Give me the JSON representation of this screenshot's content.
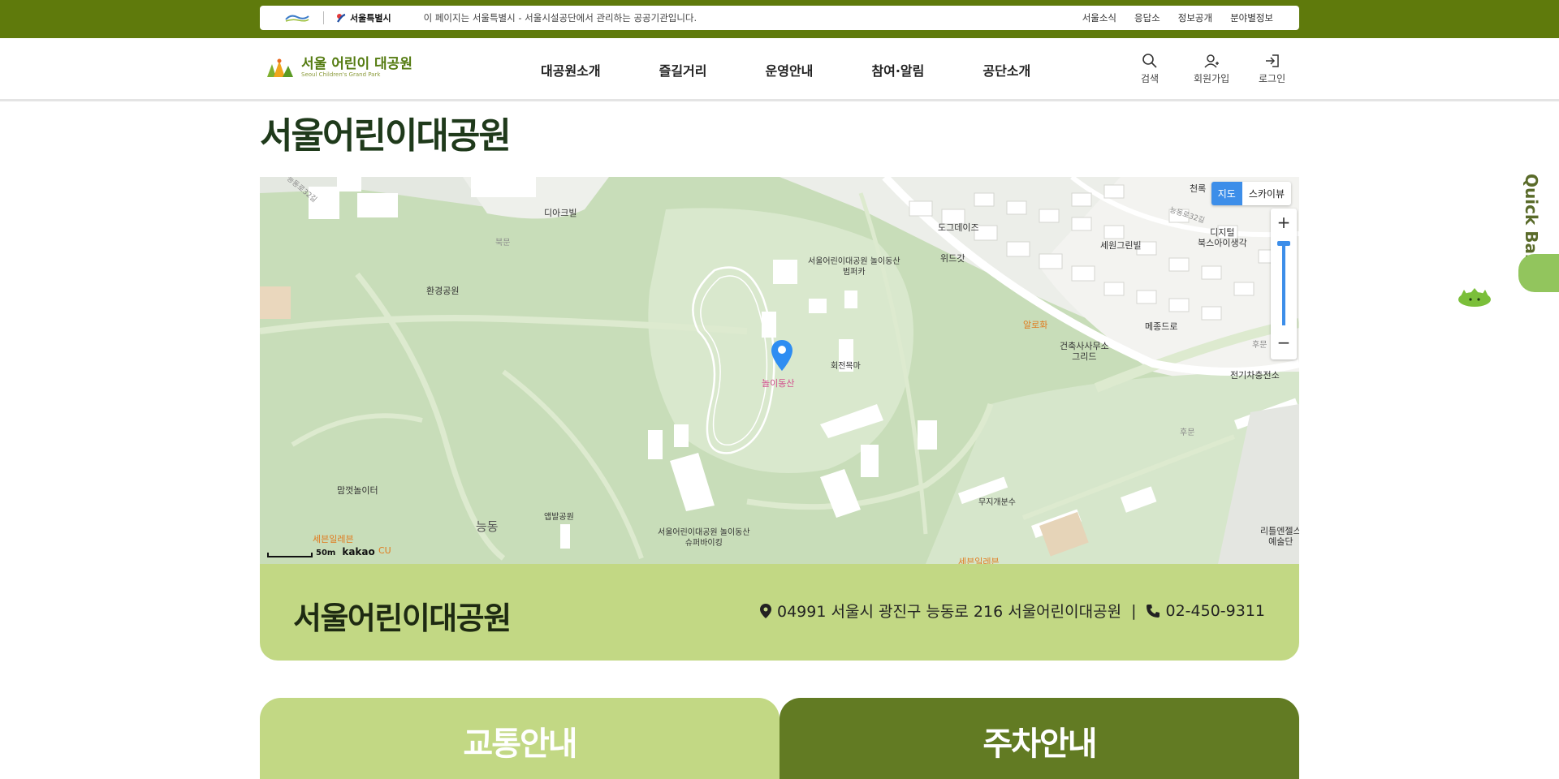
{
  "gov_bar": {
    "logo_text": "서울특별시",
    "notice": "이 페이지는 서울특별시 - 서울시설공단에서 관리하는 공공기관입니다.",
    "links": [
      "서울소식",
      "응답소",
      "정보공개",
      "분야별정보"
    ]
  },
  "header": {
    "logo_main": "서울 어린이 대공원",
    "logo_sub": "Seoul Children's Grand Park",
    "nav": [
      "대공원소개",
      "즐길거리",
      "운영안내",
      "참여·알림",
      "공단소개"
    ],
    "utils": [
      {
        "label": "검색",
        "icon": "search-icon"
      },
      {
        "label": "회원가입",
        "icon": "user-add-icon"
      },
      {
        "label": "로그인",
        "icon": "login-icon"
      }
    ]
  },
  "page": {
    "title": "서울어린이대공원"
  },
  "map": {
    "toggle": [
      "지도",
      "스카이뷰"
    ],
    "active_toggle": "지도",
    "zoom_in": "+",
    "zoom_out": "−",
    "scale": "50m",
    "provider": "kakao",
    "labels": {
      "diakvil": "디아크빌",
      "bukmun": "북문",
      "hwangyeong": "환경공원",
      "bumpercar": "서울어린이대공원 놀이동산\n범퍼카",
      "hoejeonmokma": "회전목마",
      "noridongsan": "놀이동산",
      "dogdays": "도그데이즈",
      "widgat": "위드갓",
      "alohwa": "알로화",
      "architect": "건축사사무소\n그리드",
      "sewongreenvil": "세원그린빌",
      "digital": "디지털\n북스아이생각",
      "mejongdro": "메종드로",
      "cheollok": "천록",
      "ev_station": "전기차충전소",
      "humun1": "후문",
      "humun2": "후문",
      "mamggot": "맘껏놀이터",
      "neungdong": "능동",
      "aepbal": "앱발공원",
      "superviking": "서울어린이대공원 놀이동산\n슈퍼바이킹",
      "mujigae": "무지개분수",
      "seven1": "세븐일레븐",
      "cu": "CU",
      "seven2": "세븐일레븐",
      "little": "리틀엔젤스\n예술단",
      "neungdong_road": "능동로32길",
      "neungdong_road2": "능동로32길"
    }
  },
  "info": {
    "name": "서울어린이대공원",
    "address": "04991 서울시 광진구 능동로 216 서울어린이대공원",
    "separator": "|",
    "phone": "02-450-9311"
  },
  "tabs": {
    "traffic": "교통안내",
    "parking": "주차안내"
  },
  "quickbar": {
    "label": "Quick Bar"
  },
  "colors": {
    "gov_bar": "#5f7a0c",
    "accent_light": "#c2d884",
    "accent_dark": "#627b23",
    "map_active": "#3d8ee9"
  }
}
